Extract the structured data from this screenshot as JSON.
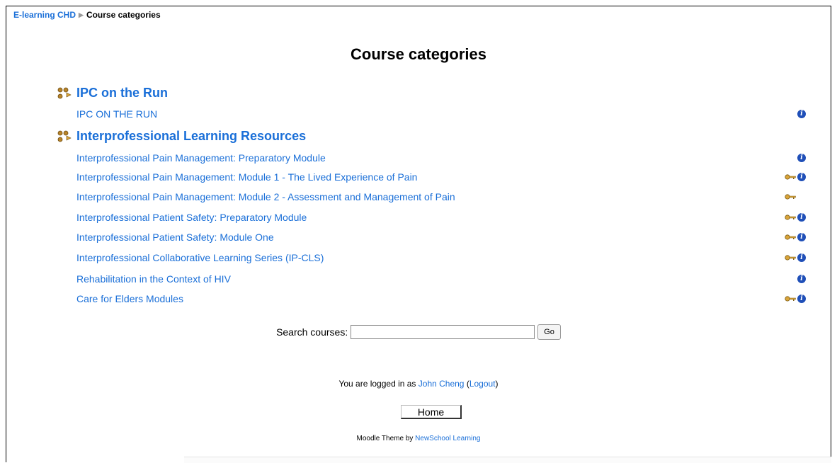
{
  "breadcrumb": {
    "home": "E-learning CHD",
    "separator": "▶",
    "current": "Course categories"
  },
  "page_title": "Course categories",
  "categories": [
    {
      "name": "IPC on the Run",
      "courses": [
        {
          "name": "IPC ON THE RUN",
          "key": false,
          "info": true
        }
      ]
    },
    {
      "name": "Interprofessional Learning Resources",
      "courses": [
        {
          "name": "Interprofessional Pain Management: Preparatory Module",
          "key": false,
          "info": true
        },
        {
          "name": "Interprofessional Pain Management: Module 1 - The Lived Experience of Pain",
          "key": true,
          "info": true
        },
        {
          "name": "Interprofessional Pain Management: Module 2 - Assessment and Management of Pain",
          "key": true,
          "info": false
        },
        {
          "name": "Interprofessional Patient Safety: Preparatory Module",
          "key": true,
          "info": true
        },
        {
          "name": "Interprofessional Patient Safety: Module One",
          "key": true,
          "info": true
        },
        {
          "name": "Interprofessional Collaborative Learning Series (IP-CLS)",
          "key": true,
          "info": true
        },
        {
          "name": "Rehabilitation in the Context of HIV",
          "key": false,
          "info": true
        },
        {
          "name": "Care for Elders Modules",
          "key": true,
          "info": true
        }
      ]
    }
  ],
  "search": {
    "label": "Search courses:",
    "value": "",
    "button": "Go"
  },
  "login": {
    "prefix": "You are logged in as ",
    "user": "John Cheng",
    "open_paren": " (",
    "logout": "Logout",
    "close_paren": ")"
  },
  "home_button": "Home",
  "footer": {
    "prefix": "Moodle Theme by ",
    "link": "NewSchool Learning"
  },
  "icons": {
    "category": "category-icon",
    "key": "key-icon",
    "info": "info-icon",
    "info_glyph": "i"
  },
  "colors": {
    "link": "#1a6fd8",
    "info": "#1f4fb8",
    "key": "#c8962e"
  }
}
